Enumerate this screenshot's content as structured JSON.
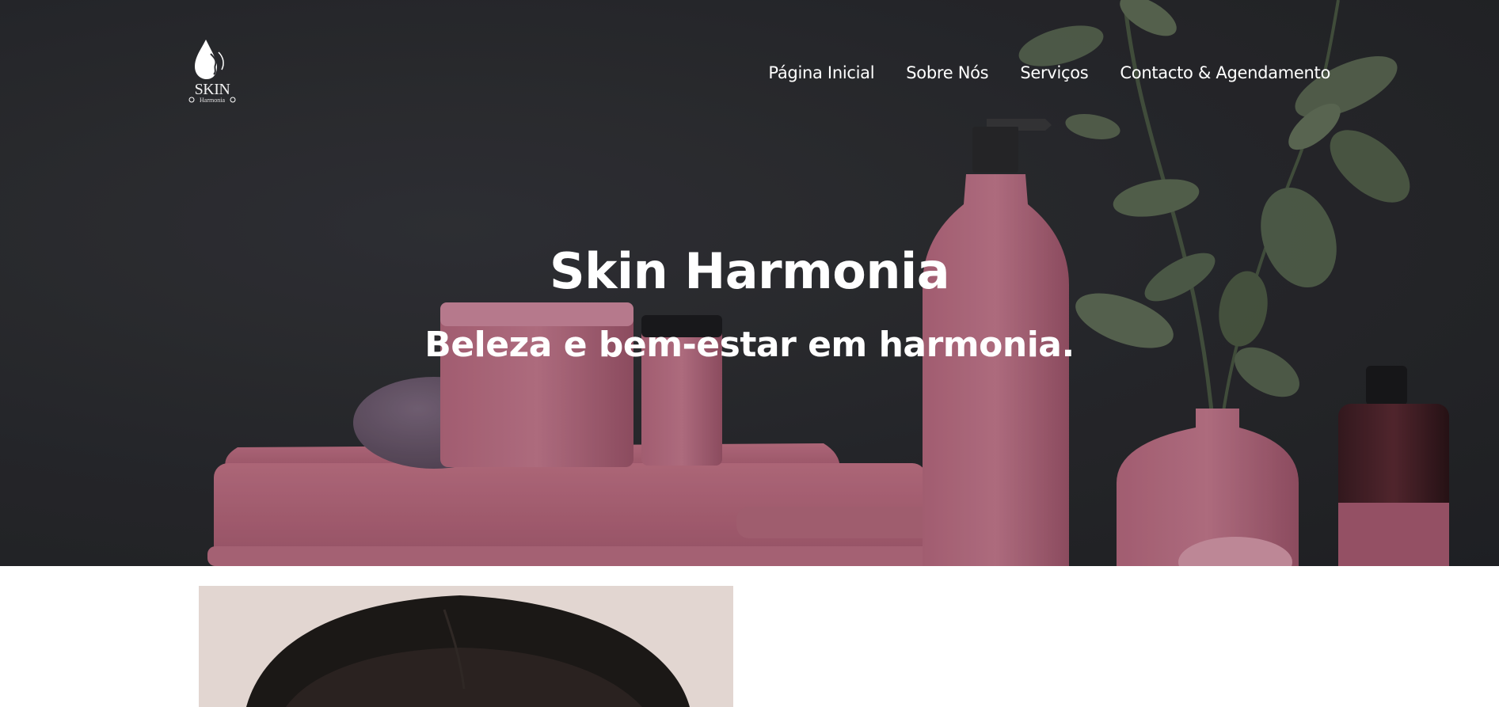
{
  "brand": {
    "logo_main": "SKIN",
    "logo_sub": "Harmonia",
    "accent_pink": "#b7687f",
    "background_dark": "#2a2b2f"
  },
  "nav": {
    "items": [
      {
        "label": "Página Inicial"
      },
      {
        "label": "Sobre Nós"
      },
      {
        "label": "Serviços"
      },
      {
        "label": "Contacto & Agendamento"
      }
    ]
  },
  "hero": {
    "title": "Skin Harmonia",
    "subtitle": "Beleza e bem-estar em harmonia."
  }
}
